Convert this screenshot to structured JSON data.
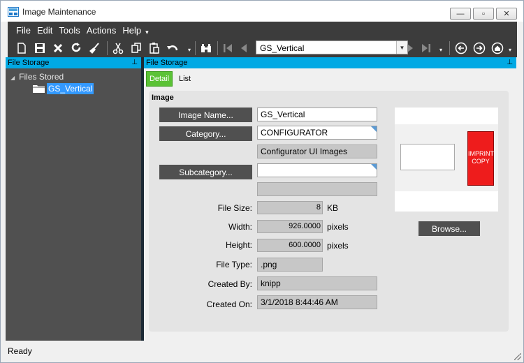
{
  "window": {
    "title": "Image Maintenance",
    "minimize": "—",
    "maximize": "▫",
    "close": "✕"
  },
  "menu": {
    "items": [
      "File",
      "Edit",
      "Tools",
      "Actions",
      "Help"
    ],
    "overflow": "▾"
  },
  "toolbar": {
    "nav_value": "GS_Vertical",
    "icons": [
      "new-icon",
      "save-icon",
      "delete-icon",
      "refresh-icon",
      "clear-icon",
      "cut-icon",
      "copy-icon",
      "paste-icon",
      "undo-icon",
      "search-icon",
      "first-icon",
      "previous-icon",
      "next-icon",
      "last-icon",
      "back-icon",
      "forward-icon",
      "home-icon"
    ]
  },
  "left_panel": {
    "header": "File Storage",
    "pin": "⊥",
    "tree_root": "Files Stored",
    "tree_child": "GS_Vertical"
  },
  "right_panel": {
    "header": "File Storage",
    "pin": "⊥",
    "tabs": [
      "Detail",
      "List"
    ],
    "group_title": "Image"
  },
  "form": {
    "image_name_button": "Image Name...",
    "image_name": "GS_Vertical",
    "category_button": "Category...",
    "category": "CONFIGURATOR",
    "category_desc": "Configurator UI Images",
    "subcategory_button": "Subcategory...",
    "subcategory": "",
    "subcategory_desc": "",
    "file_size_label": "File Size:",
    "file_size": "8",
    "file_size_unit": "KB",
    "width_label": "Width:",
    "width": "926.0000",
    "width_unit": "pixels",
    "height_label": "Height:",
    "height": "600.0000",
    "height_unit": "pixels",
    "file_type_label": "File Type:",
    "file_type": ".png",
    "created_by_label": "Created By:",
    "created_by": "knipp",
    "created_on_label": "Created On:",
    "created_on": "3/1/2018 8:44:46 AM"
  },
  "preview": {
    "stamp_line1": "IMPRINT",
    "stamp_line2": "COPY",
    "browse_button": "Browse..."
  },
  "status": {
    "text": "Ready"
  },
  "colors": {
    "accent": "#00a9e4",
    "tab_active": "#5bc236",
    "dark": "#3c3c3c",
    "stamp": "#ee1c1c"
  }
}
